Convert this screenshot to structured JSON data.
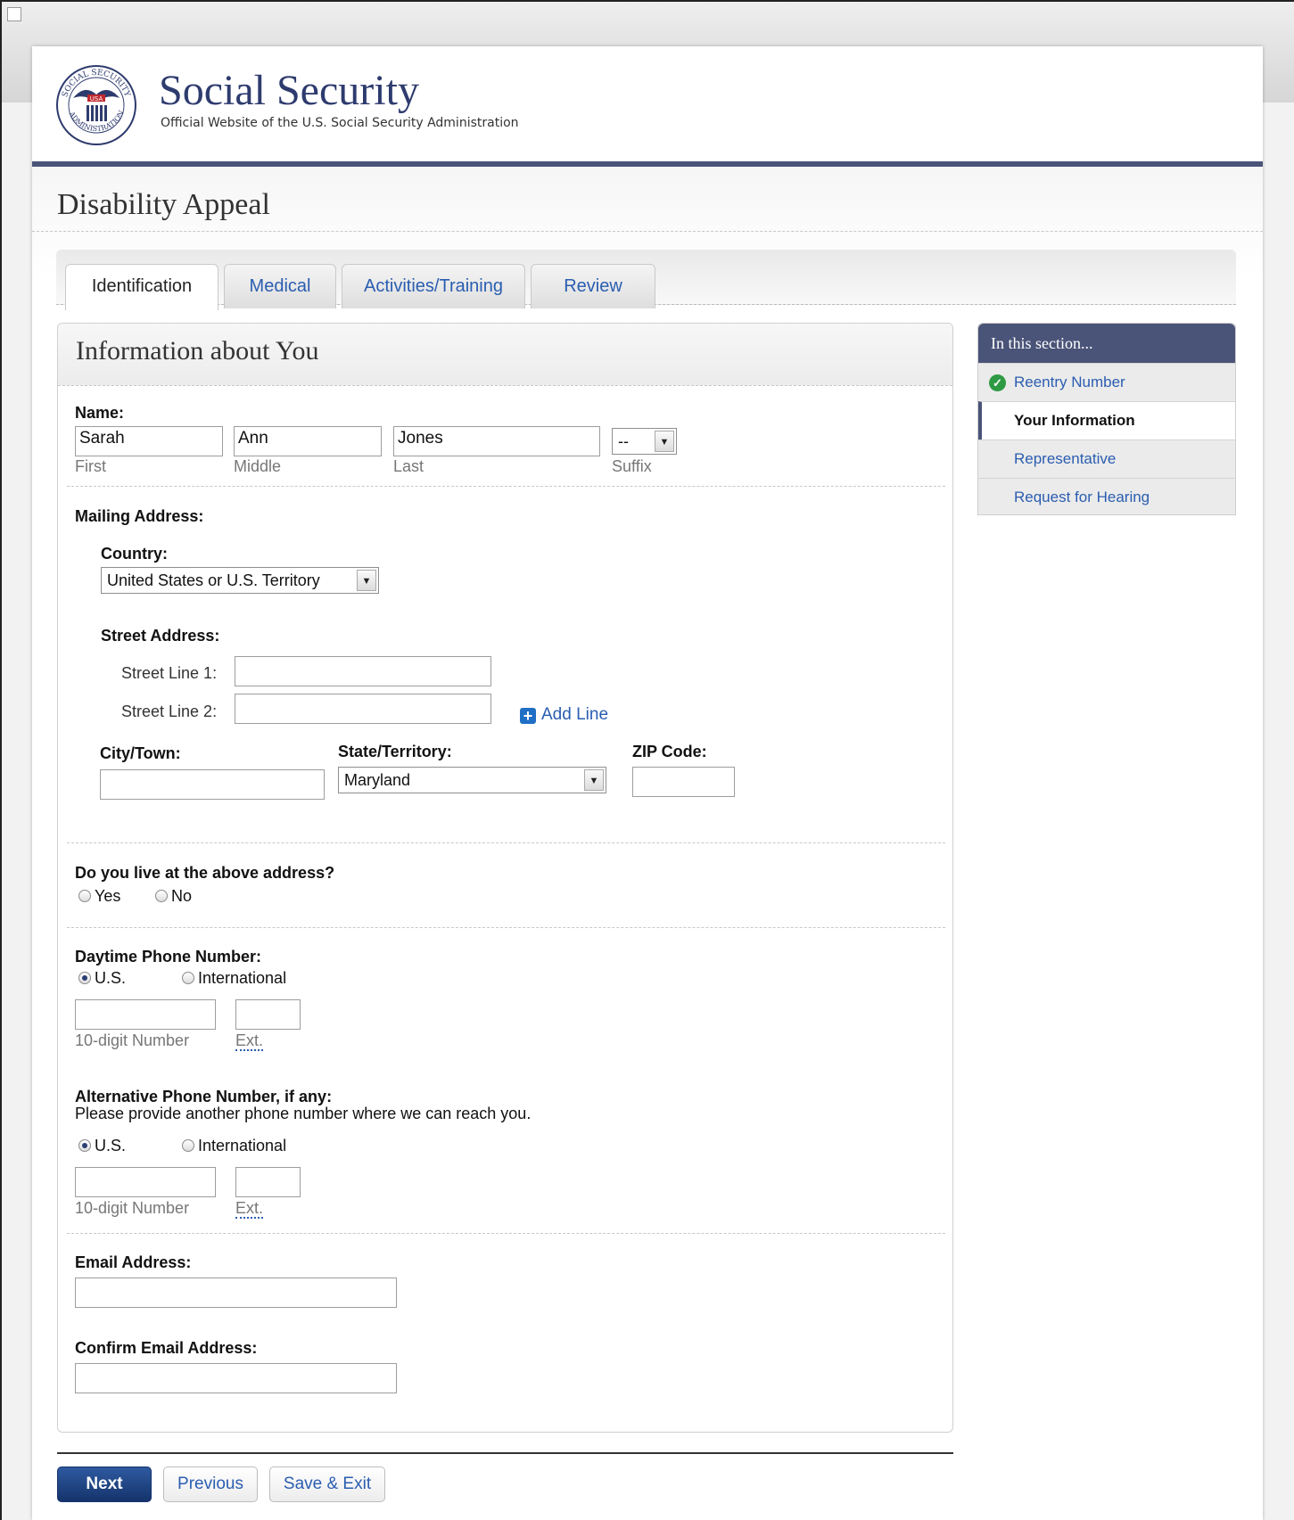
{
  "header": {
    "site_title": "Social Security",
    "site_subtitle": "Official Website of the U.S. Social Security Administration",
    "seal_text": "SOCIAL SECURITY ADMINISTRATION USA",
    "seal_badge": "USA"
  },
  "app": {
    "title": "Disability Appeal"
  },
  "tabs": [
    {
      "label": "Identification"
    },
    {
      "label": "Medical"
    },
    {
      "label": "Activities/Training"
    },
    {
      "label": "Review"
    }
  ],
  "panel": {
    "title": "Information about You"
  },
  "name": {
    "label": "Name:",
    "first": {
      "value": "Sarah",
      "hint": "First"
    },
    "middle": {
      "value": "Ann",
      "hint": "Middle"
    },
    "last": {
      "value": "Jones",
      "hint": "Last"
    },
    "suffix": {
      "value": "--",
      "hint": "Suffix"
    }
  },
  "mailing": {
    "label": "Mailing Address:",
    "country_label": "Country:",
    "country_value": "United States or U.S. Territory",
    "street_label": "Street Address:",
    "street1_label": "Street Line 1:",
    "street2_label": "Street Line 2:",
    "add_line": "Add Line",
    "city_label": "City/Town:",
    "state_label": "State/Territory:",
    "state_value": "Maryland",
    "zip_label": "ZIP Code:"
  },
  "live": {
    "question": "Do you live at the above address?",
    "yes": "Yes",
    "no": "No"
  },
  "daytime": {
    "label": "Daytime Phone Number:",
    "us": "U.S.",
    "intl": "International",
    "number_hint": "10-digit Number",
    "ext_hint": "Ext."
  },
  "alt": {
    "label": "Alternative Phone Number, if any:",
    "note": "Please provide another phone number where we can reach you.",
    "us": "U.S.",
    "intl": "International",
    "number_hint": "10-digit Number",
    "ext_hint": "Ext."
  },
  "email": {
    "label": "Email Address:",
    "confirm_label": "Confirm Email Address:"
  },
  "sidebar": {
    "title": "In this section...",
    "items": [
      {
        "label": "Reentry Number"
      },
      {
        "label": "Your Information"
      },
      {
        "label": "Representative"
      },
      {
        "label": "Request for Hearing"
      }
    ]
  },
  "buttons": {
    "next": "Next",
    "previous": "Previous",
    "save_exit": "Save & Exit"
  },
  "colors": {
    "brand_navy": "#4a5478",
    "link_blue": "#2a5db0",
    "primary_button": "#1b3f80",
    "check_green": "#2f9a44"
  }
}
